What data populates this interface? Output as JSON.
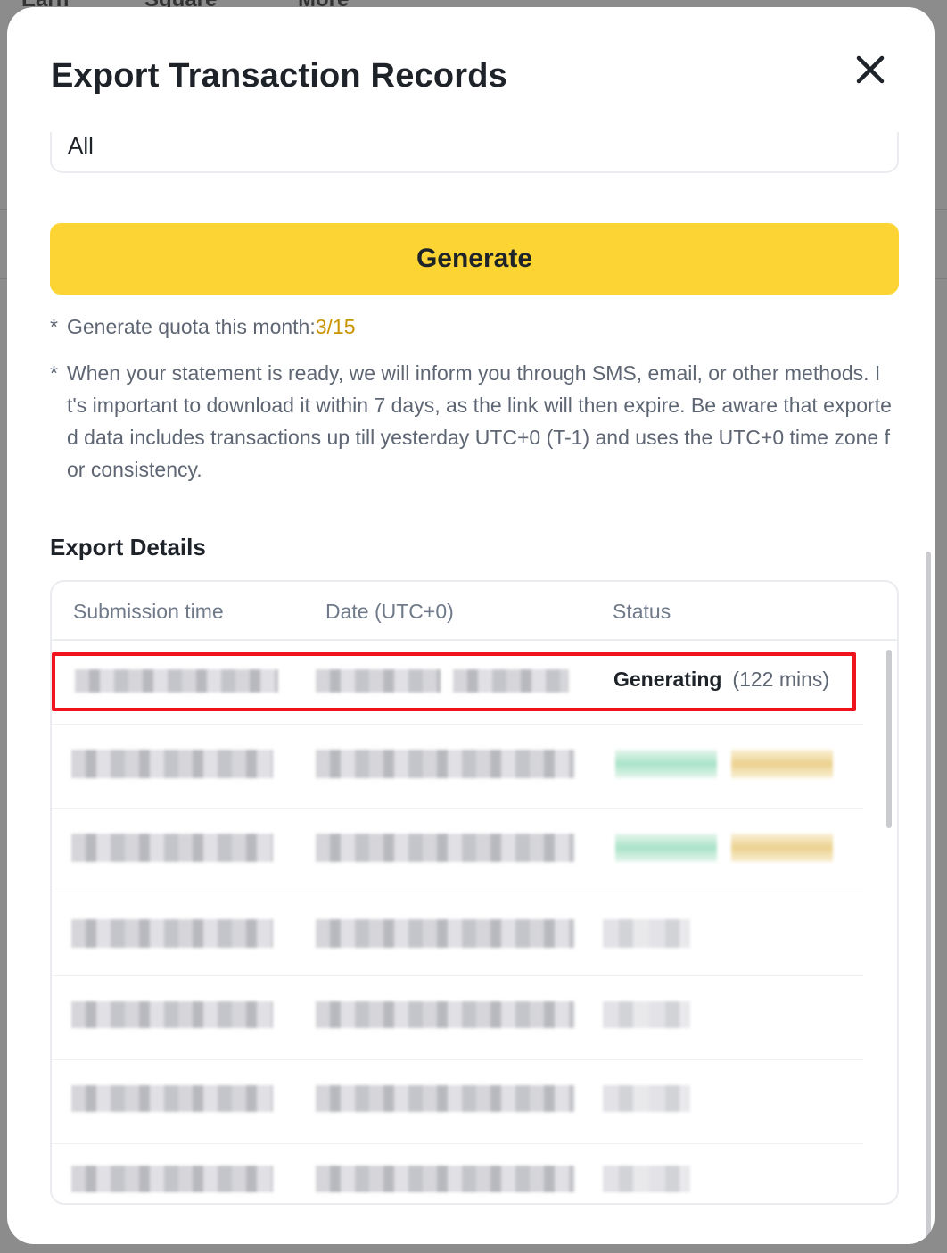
{
  "background": {
    "nav_items": [
      "Earn",
      "Square",
      "More"
    ]
  },
  "modal": {
    "title": "Export Transaction Records",
    "close_icon": "close-icon",
    "select_value": "All",
    "generate_label": "Generate",
    "quota_label": "Generate quota this month:",
    "quota_value": "3/15",
    "notice": "When your statement is ready, we will inform you through SMS, email, or other methods. It's important to download it within 7 days, as the link will then expire. Be aware that exported data includes transactions up till yesterday UTC+0 (T-1) and uses the UTC+0 time zone for consistency.",
    "star": "*"
  },
  "export_details": {
    "title": "Export Details",
    "columns": [
      "Submission time",
      "Date (UTC+0)",
      "Status"
    ],
    "highlighted_row": {
      "status": "Generating",
      "eta": "(122 mins)"
    }
  },
  "colors": {
    "accent": "#fcd535",
    "quota": "#c99400",
    "highlight": "#f0141e"
  }
}
